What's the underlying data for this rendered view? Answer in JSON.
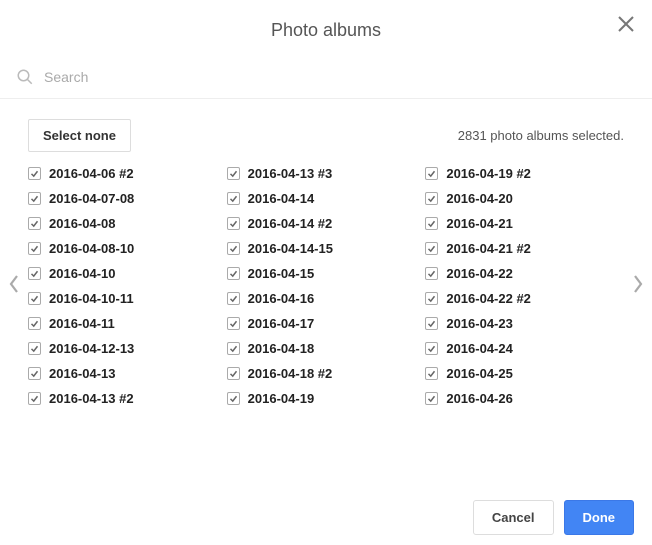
{
  "header": {
    "title": "Photo albums"
  },
  "search": {
    "placeholder": "Search"
  },
  "controls": {
    "select_none_label": "Select none",
    "status_text": "2831 photo albums selected."
  },
  "columns": [
    [
      "2016-04-06 #2",
      "2016-04-07-08",
      "2016-04-08",
      "2016-04-08-10",
      "2016-04-10",
      "2016-04-10-11",
      "2016-04-11",
      "2016-04-12-13",
      "2016-04-13",
      "2016-04-13 #2"
    ],
    [
      "2016-04-13 #3",
      "2016-04-14",
      "2016-04-14 #2",
      "2016-04-14-15",
      "2016-04-15",
      "2016-04-16",
      "2016-04-17",
      "2016-04-18",
      "2016-04-18 #2",
      "2016-04-19"
    ],
    [
      "2016-04-19 #2",
      "2016-04-20",
      "2016-04-21",
      "2016-04-21 #2",
      "2016-04-22",
      "2016-04-22 #2",
      "2016-04-23",
      "2016-04-24",
      "2016-04-25",
      "2016-04-26"
    ]
  ],
  "footer": {
    "cancel_label": "Cancel",
    "done_label": "Done"
  }
}
